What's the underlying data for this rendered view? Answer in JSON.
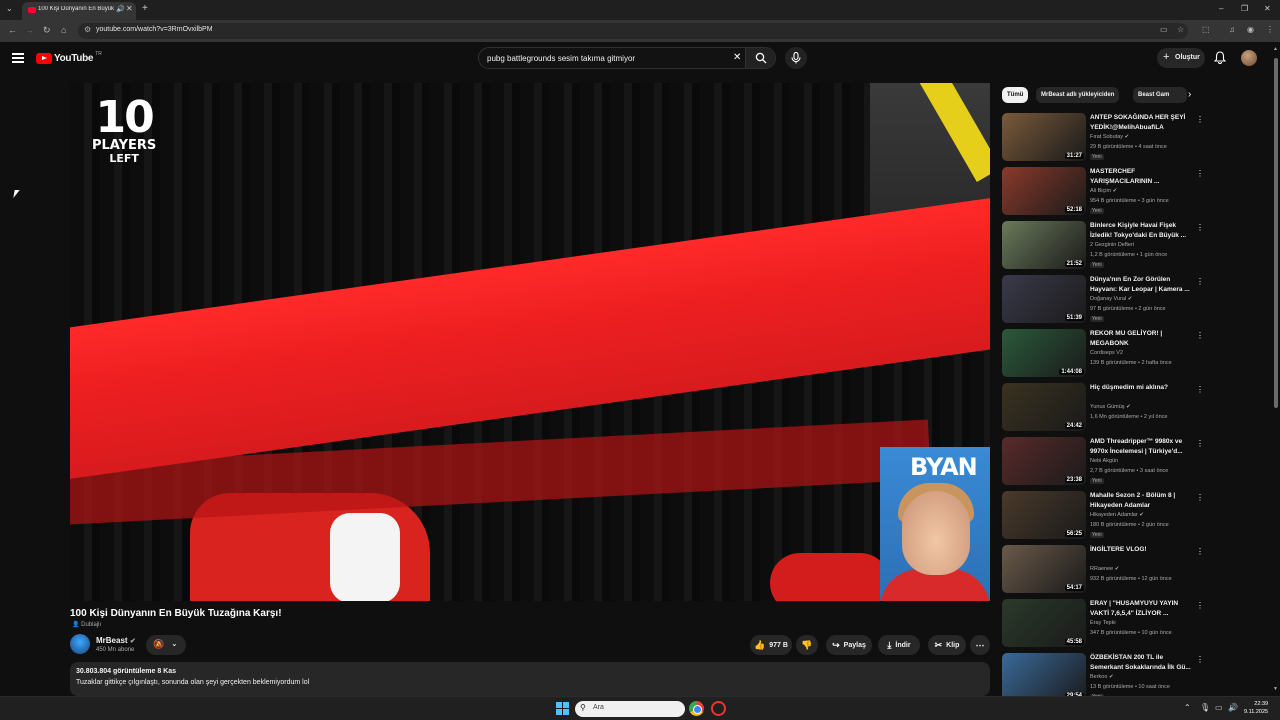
{
  "browser": {
    "tab_title": "100 Kişi Dünyanın En Büyük Tuzağına Karşı!",
    "url": "youtube.com/watch?v=3RmOvxilbPM"
  },
  "header": {
    "logo_text": "YouTube",
    "country_code": "TR",
    "search_query": "pubg battlegrounds sesim takıma gitmiyor",
    "create_label": "Oluştur"
  },
  "video": {
    "overlay_count": "10",
    "overlay_line1": "PLAYERS",
    "overlay_line2": "LEFT",
    "cam_name": "BYAN",
    "title": "100 Kişi Dünyanın En Büyük Tuzağına Karşı!",
    "dub_label": "Dublajlı",
    "channel": "MrBeast",
    "subscribers": "450 Mn abone",
    "likes": "977 B",
    "share_label": "Paylaş",
    "download_label": "İndir",
    "clip_label": "Klip",
    "views_date": "30.803.804 görüntüleme  8 Kas",
    "description": "Tuzaklar gittikçe çılgınlaştı, sonunda olan şeyi gerçekten beklemiyordum lol"
  },
  "chips": [
    "Tümü",
    "MrBeast adlı yükleyiciden",
    "Beast Gam"
  ],
  "recommendations": [
    {
      "title": "ANTEP SOKAĞINDA HER ŞEYİ YEDİK!@MelihAbuaf\\LA",
      "channel": "Fırat Sobutay",
      "verified": true,
      "meta": "29 B görüntüleme • 4 saat önce",
      "duration": "31:27",
      "new": "Yeni",
      "thumb_color": "#7a5a3a"
    },
    {
      "title": "MASTERCHEF YARIŞMACILARININ ...",
      "channel": "Ali Biçim",
      "verified": true,
      "meta": "954 B görüntüleme • 3 gün önce",
      "duration": "52:18",
      "new": "Yeni",
      "thumb_color": "#8a3a2a"
    },
    {
      "title": "Binlerce Kişiyle Havai Fişek İzledik! Tokyo'daki En Büyük ...",
      "channel": "2 Gezginin Defteri",
      "verified": false,
      "meta": "1,2 B görüntüleme • 1 gün önce",
      "duration": "21:52",
      "new": "Yeni",
      "thumb_color": "#6a7a5a"
    },
    {
      "title": "Dünya'nın En Zor Görülen Hayvanı: Kar Leopar | Kamera ...",
      "channel": "Doğanay Vural",
      "verified": true,
      "meta": "97 B görüntüleme • 2 gün önce",
      "duration": "51:39",
      "new": "Yeni",
      "thumb_color": "#3a3a4a"
    },
    {
      "title": "REKOR MU GELİYOR! | MEGABONK",
      "channel": "Cordiseps V2",
      "verified": false,
      "meta": "139 B görüntüleme • 2 hafta önce",
      "duration": "1:44:08",
      "new": "",
      "thumb_color": "#2a5a3a"
    },
    {
      "title": "Hiç düşmedim mi aklına?",
      "channel": "Yunus Gümüş",
      "verified": true,
      "meta": "1,6 Mn görüntüleme • 2 yıl önce",
      "duration": "24:42",
      "new": "",
      "thumb_color": "#3a3220"
    },
    {
      "title": "AMD Threadripper™ 9980x ve 9970x İncelemesi | Türkiye'd...",
      "channel": "Nebi Akgün",
      "verified": false,
      "meta": "2,7 B görüntüleme • 3 saat önce",
      "duration": "23:38",
      "new": "Yeni",
      "thumb_color": "#5a2a2a"
    },
    {
      "title": "Mahalle Sezon 2 - Bölüm 8 | Hikayeden Adamlar",
      "channel": "Hikayeden Adamlar",
      "verified": true,
      "meta": "180 B görüntüleme • 2 gün önce",
      "duration": "56:25",
      "new": "Yeni",
      "thumb_color": "#4a3a2a"
    },
    {
      "title": "İNGİLTERE VLOG!",
      "channel": "RRaenee",
      "verified": true,
      "meta": "932 B görüntüleme • 12 gün önce",
      "duration": "54:17",
      "new": "",
      "thumb_color": "#6a5a4a"
    },
    {
      "title": "ERAY | \"HUSAMYUYU YAYIN VAKTİ 7,6,5,4\" İZLİYOR ...",
      "channel": "Eray Tepki",
      "verified": false,
      "meta": "347 B görüntüleme • 10 gün önce",
      "duration": "45:58",
      "new": "",
      "thumb_color": "#2a3a2a"
    },
    {
      "title": "ÖZBEKİSTAN 200 TL ile Semerkant Sokaklarında İlk Gü...",
      "channel": "Berkoo",
      "verified": true,
      "meta": "13 B görüntüleme • 10 saat önce",
      "duration": "29:54",
      "new": "Yeni",
      "thumb_color": "#3a6a9a"
    }
  ],
  "taskbar": {
    "search_placeholder": "Ara",
    "time": "22:39",
    "date": "9.11.2025"
  }
}
